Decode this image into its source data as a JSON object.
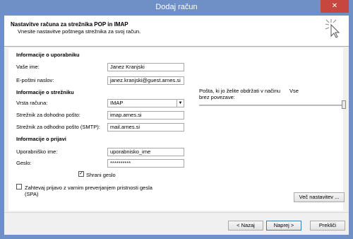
{
  "window": {
    "title": "Dodaj račun",
    "close_label": "✕"
  },
  "header": {
    "title": "Nastavitve računa za strežnika POP in IMAP",
    "subtitle": "Vnesite nastavitve poštnega strežnika za svoj račun."
  },
  "user_info": {
    "section_title": "Informacije o uporabniku",
    "name_label": "Vaše ime:",
    "name_value": "Janez Kranjski",
    "email_label": "E-poštni naslov:",
    "email_value": "janez.kranjski@guest.arnes.si"
  },
  "server_info": {
    "section_title": "Informacije o strežniku",
    "account_type_label": "Vrsta računa:",
    "account_type_value": "IMAP",
    "incoming_label": "Strežnik za dohodno pošto:",
    "incoming_value": "imap.arnes.si",
    "outgoing_label": "Strežnik za odhodno pošto (SMTP):",
    "outgoing_value": "mail.arnes.si"
  },
  "login_info": {
    "section_title": "Informacije o prijavi",
    "username_label": "Uporabniško ime:",
    "username_value": "uporabnisko_ime",
    "password_label": "Geslo:",
    "password_value": "**********",
    "remember_label": "Shrani geslo",
    "remember_checked": true,
    "spa_label_line1": "Zahtevaj prijavo z varnim preverjanjem pristnosti gesla",
    "spa_label_line2": "(SPA)",
    "spa_checked": false
  },
  "offline": {
    "label_line1": "Pošta, ki jo želite obdržati v načinu",
    "label_line2": "brez povezave:",
    "value": "Vse",
    "slider_fraction": 1.0
  },
  "buttons": {
    "more_settings": "Več nastavitev ...",
    "back": "< Nazaj",
    "next": "Naprej >",
    "cancel": "Prekliči"
  },
  "colors": {
    "titlebar": "#6f8fc7",
    "close": "#c7463f"
  }
}
